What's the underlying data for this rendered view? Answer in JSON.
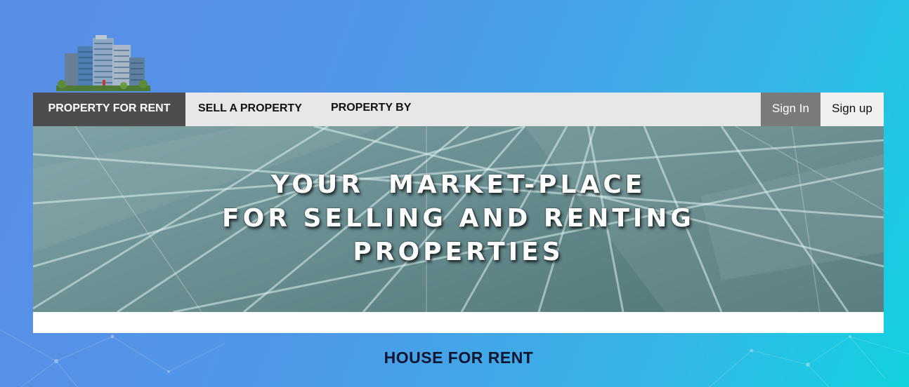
{
  "logo": {
    "icon": "buildings-logo"
  },
  "nav": {
    "items": [
      {
        "label": "PROPERTY FOR RENT",
        "active": true
      },
      {
        "label": "SELL A PROPERTY",
        "active": false
      },
      {
        "label": "PROPERTY BY",
        "active": false
      }
    ],
    "signin_label": "Sign In",
    "signup_label": "Sign up"
  },
  "hero": {
    "lines": [
      "YOUR  MARKET-PLACE",
      "FOR SELLING AND RENTING",
      "PROPERTIES"
    ]
  },
  "section": {
    "title": "HOUSE FOR RENT"
  },
  "colors": {
    "nav_active_bg": "#4d4d4d",
    "nav_bg": "#e7e7e7",
    "signin_bg": "#7a7a7a",
    "background_start": "#5a8de6",
    "background_end": "#12d2e0"
  }
}
